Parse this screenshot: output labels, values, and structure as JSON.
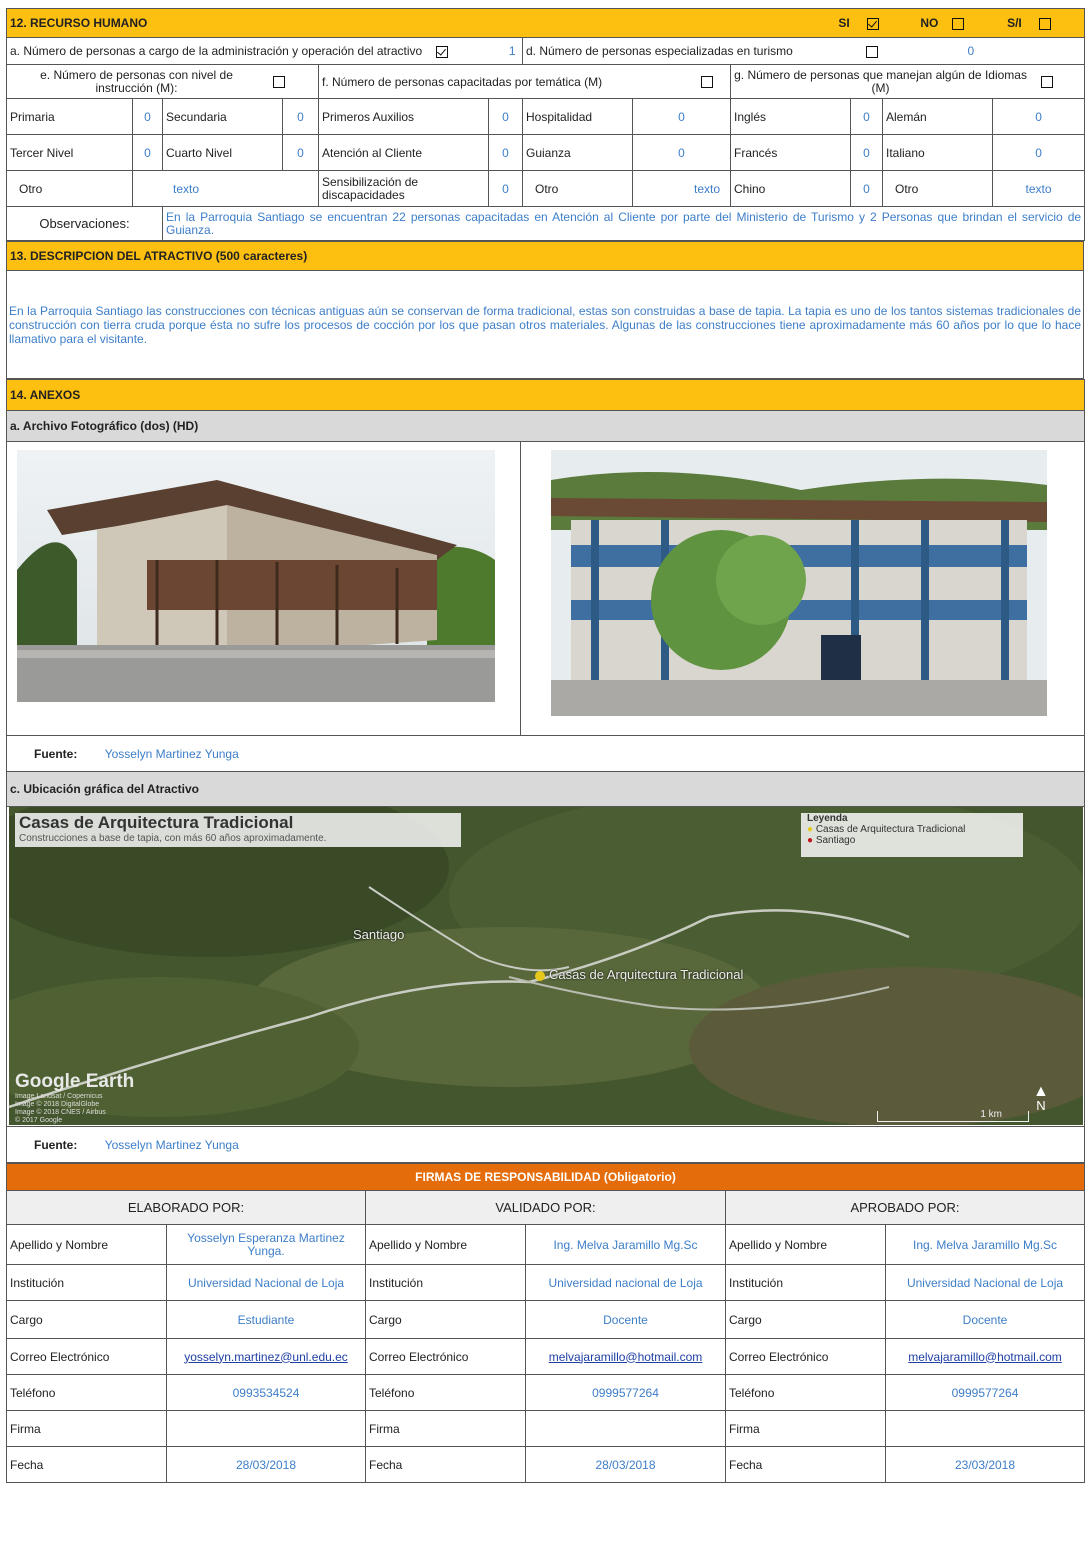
{
  "s12": {
    "title": "12. RECURSO HUMANO",
    "si": "SI",
    "no": "NO",
    "sn": "S/I",
    "a_label": "a. Número de personas a cargo de la administración y operación del atractivo",
    "a_value": "1",
    "d_label": "d. Número de personas especializadas en turismo",
    "d_value": "0",
    "e_label": "e. Número de personas con nivel de instrucción (M):",
    "f_label": "f. Número de personas capacitadas por temática (M)",
    "g_label": "g. Número de personas que manejan algún de Idiomas (M)",
    "rows": [
      [
        "Primaria",
        "0",
        "Secundaria",
        "0",
        "Primeros Auxilios",
        "0",
        "Hospitalidad",
        "0",
        "Inglés",
        "0",
        "Alemán",
        "0"
      ],
      [
        "Tercer Nivel",
        "0",
        "Cuarto Nivel",
        "0",
        "Atención al Cliente",
        "0",
        "Guianza",
        "0",
        "Francés",
        "0",
        "Italiano",
        "0"
      ]
    ],
    "otro1": "Otro",
    "otro1_val": "texto",
    "sens": "Sensibilización de discapacidades",
    "sens_val": "0",
    "otro2": "Otro",
    "otro2_val": "texto",
    "chino": "Chino",
    "chino_val": "0",
    "otro3": "Otro",
    "otro3_val": "texto",
    "obs_label": "Observaciones:",
    "obs_text": "En la Parroquia Santiago se encuentran 22 personas capacitadas en Atención al Cliente por parte del Ministerio de Turismo y 2 Personas que brindan el servicio de Guianza."
  },
  "s13": {
    "title": "13. DESCRIPCION DEL ATRACTIVO (500 caracteres)",
    "text": "En la Parroquia Santiago las construcciones con técnicas antiguas aún se conservan de forma tradicional, estas son construidas a base de tapia. La tapia es uno de los tantos sistemas tradicionales de construcción con tierra cruda porque ésta no sufre los procesos de cocción por los que pasan otros materiales. Algunas de las construcciones tiene aproximadamente más 60 años por lo que lo hace llamativo para el visitante."
  },
  "s14": {
    "title": "14. ANEXOS",
    "photo_title": "a. Archivo Fotográfico (dos) (HD)",
    "fuente_label": "Fuente:",
    "fuente1": "Yosselyn Martinez Yunga",
    "map_title": "c. Ubicación gráfica del Atractivo",
    "fuente2": "Yosselyn Martinez Yunga",
    "map": {
      "heading": "Casas de Arquitectura Tradicional",
      "subheading": "Construcciones a base de tapia, con más 60 años aproximadamente.",
      "legend_title": "Leyenda",
      "legend_1": "Casas de Arquitectura Tradicional",
      "legend_2": "Santiago",
      "place_santiago": "Santiago",
      "place_casas": "Casas de Arquitectura Tradicional",
      "brand": "Google Earth",
      "credit_1": "Image Landsat / Copernicus",
      "credit_2": "Image © 2018 DigitalGlobe",
      "credit_3": "Image © 2018 CNES / Airbus",
      "credit_4": "© 2017 Google",
      "scale": "1 km",
      "north": "N"
    }
  },
  "firmas": {
    "title": "FIRMAS DE RESPONSABILIDAD (Obligatorio)",
    "cols": [
      {
        "head": "ELABORADO POR:",
        "nombre": "Yosselyn Esperanza Martinez Yunga.",
        "institucion": "Universidad Nacional de Loja",
        "cargo": "Estudiante",
        "correo": "yosselyn.martinez@unl.edu.ec",
        "telefono": "0993534524",
        "fecha": "28/03/2018"
      },
      {
        "head": "VALIDADO POR:",
        "nombre": "Ing. Melva Jaramillo Mg.Sc",
        "institucion": "Universidad nacional de Loja",
        "cargo": "Docente",
        "correo": "melvajaramillo@hotmail.com",
        "telefono": "0999577264",
        "fecha": "28/03/2018"
      },
      {
        "head": "APROBADO POR:",
        "nombre": "Ing. Melva Jaramillo Mg.Sc",
        "institucion": "Universidad Nacional de Loja",
        "cargo": "Docente",
        "correo": "melvajaramillo@hotmail.com",
        "telefono": "0999577264",
        "fecha": "23/03/2018"
      }
    ],
    "labels": {
      "nombre": "Apellido y Nombre",
      "institucion": "Institución",
      "cargo": "Cargo",
      "correo": "Correo Electrónico",
      "telefono": "Teléfono",
      "firma": "Firma",
      "fecha": "Fecha"
    }
  }
}
